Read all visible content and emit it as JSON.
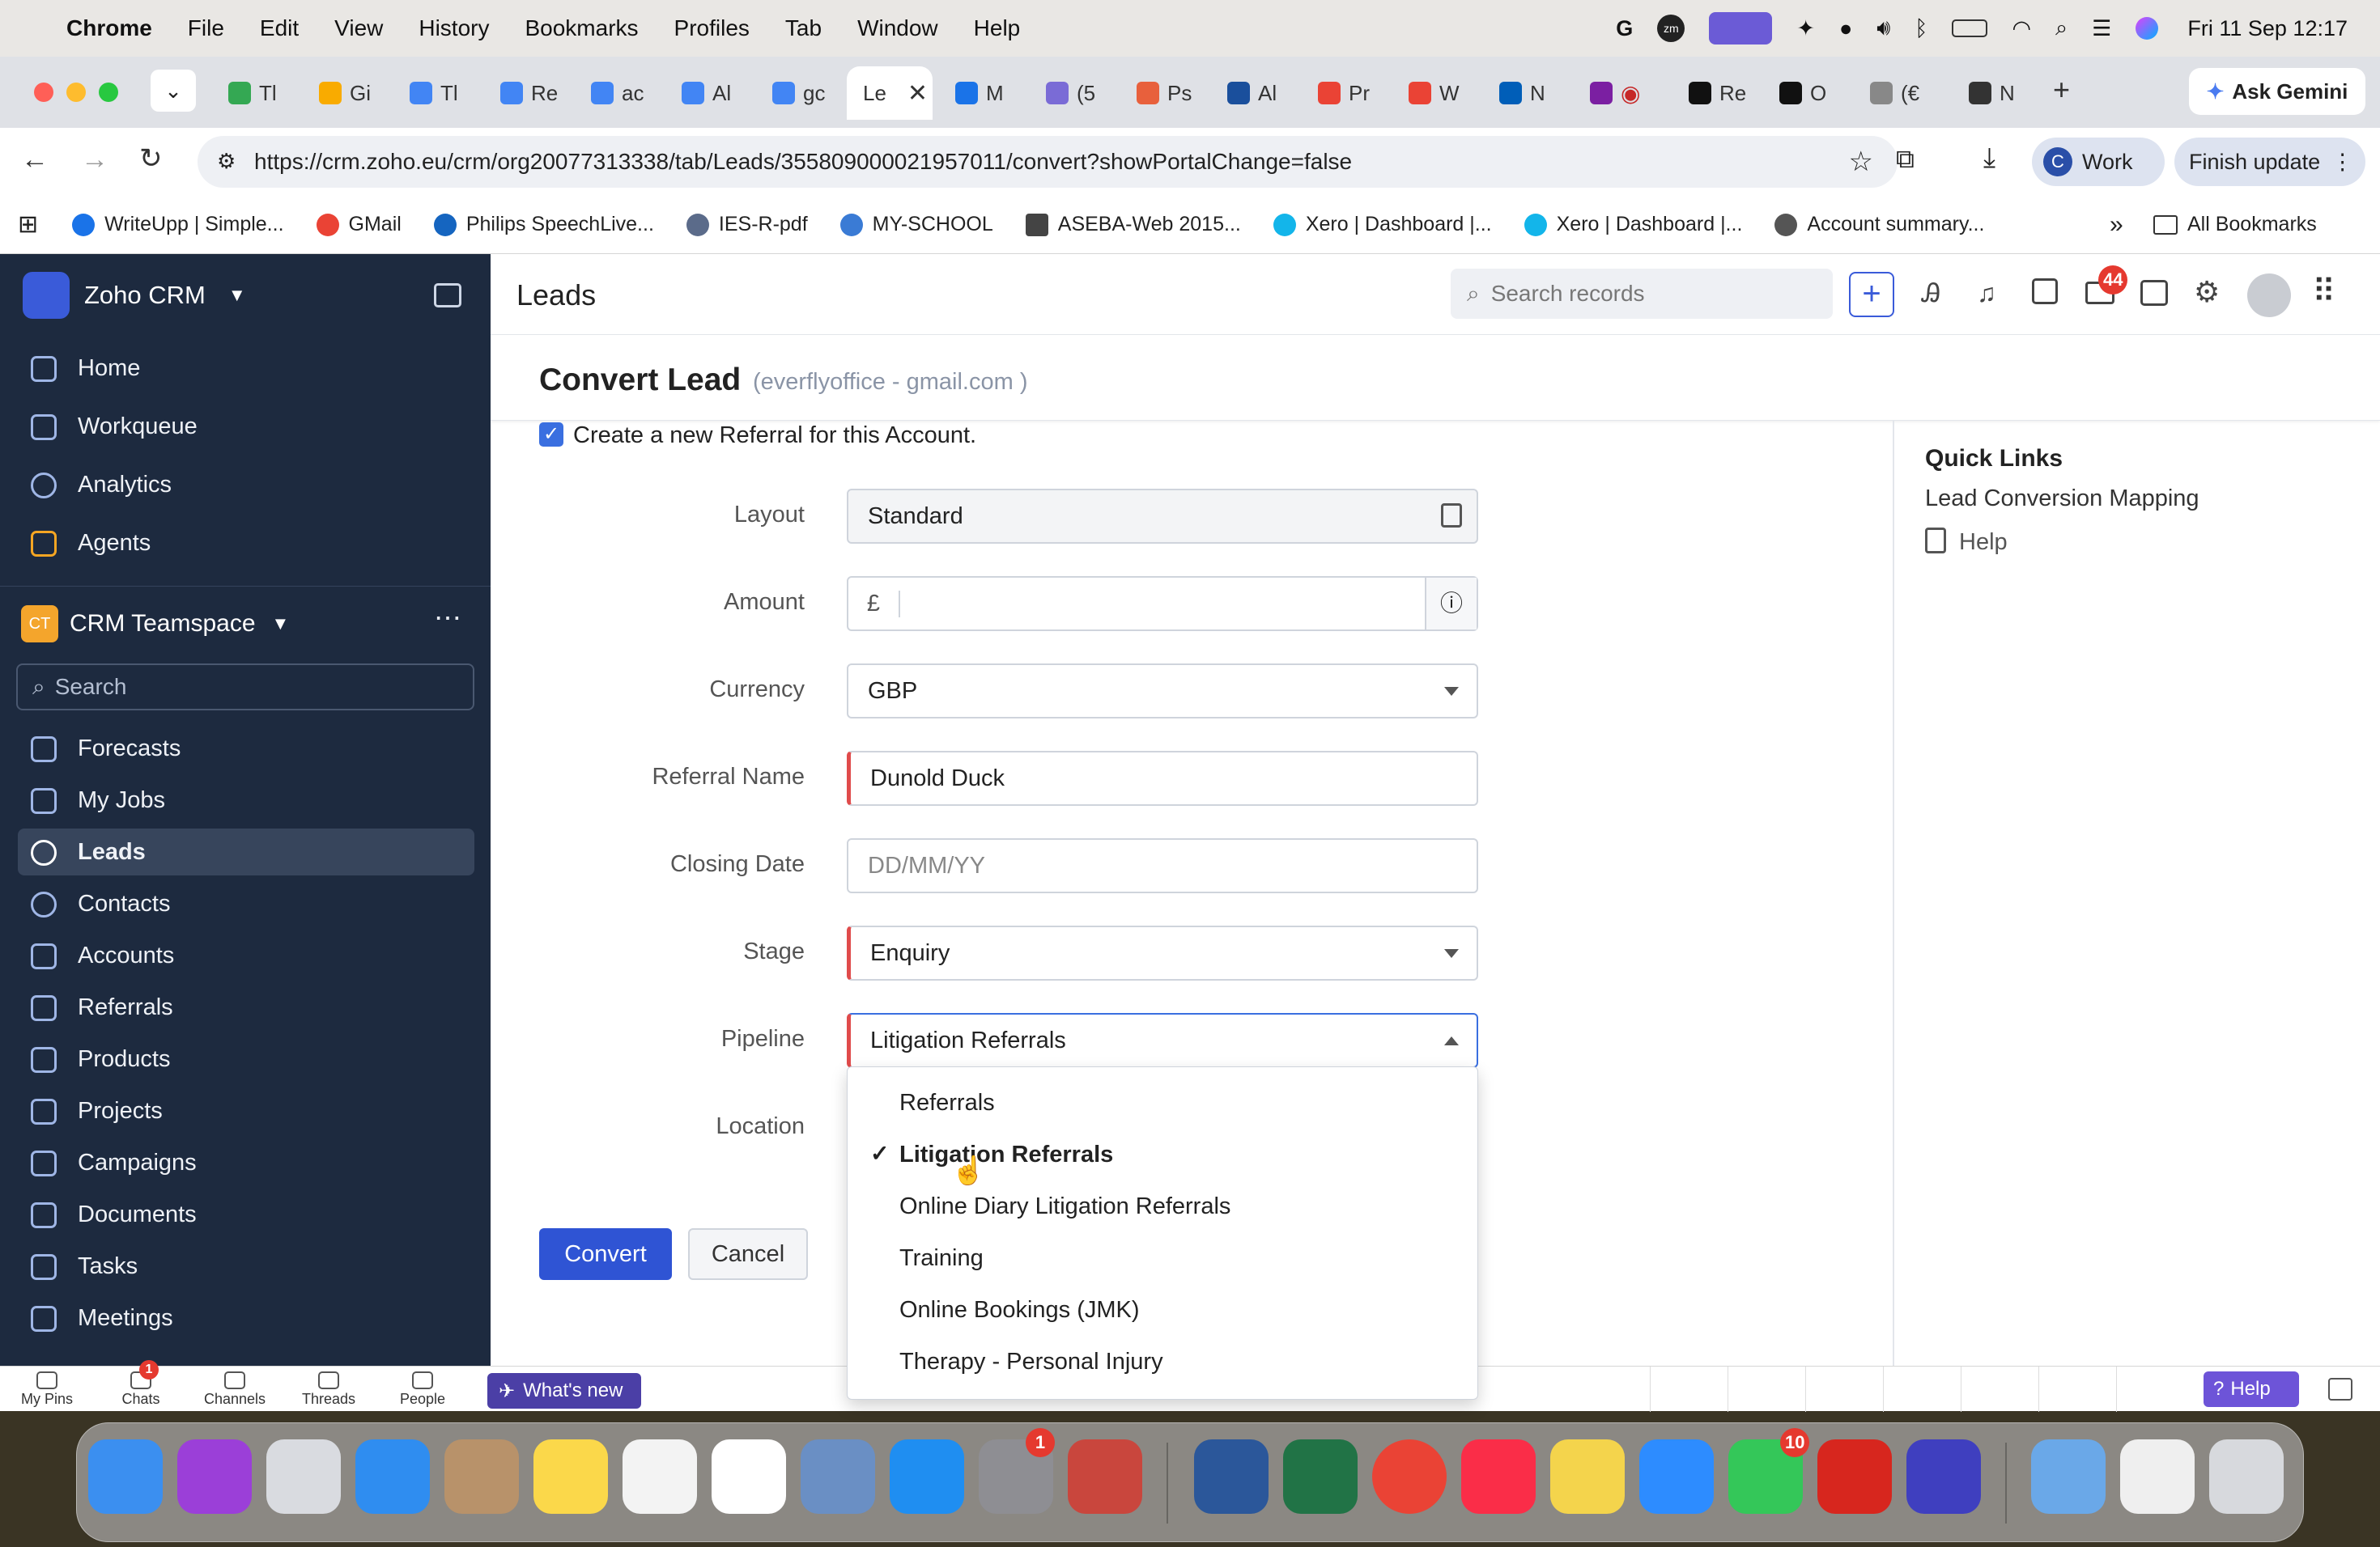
{
  "menubar": {
    "app": "Chrome",
    "items": [
      "File",
      "Edit",
      "View",
      "History",
      "Bookmarks",
      "Profiles",
      "Tab",
      "Window",
      "Help"
    ],
    "clock": "Fri 11 Sep  12:17"
  },
  "tabs": [
    {
      "label": "Tl",
      "color": "#34a853"
    },
    {
      "label": "Gi",
      "color": "#f9ab00"
    },
    {
      "label": "Tl",
      "color": "#4285f4"
    },
    {
      "label": "Re",
      "color": "#4285f4"
    },
    {
      "label": "ac",
      "color": "#4285f4"
    },
    {
      "label": "Al",
      "color": "#4285f4"
    },
    {
      "label": "gc",
      "color": "#4285f4"
    },
    {
      "label": "Le",
      "color": "#ffffff",
      "active": true
    },
    {
      "label": "M",
      "color": "#1a73e8"
    },
    {
      "label": "(5",
      "color": "#7a6bd6"
    },
    {
      "label": "Ps",
      "color": "#e8603c"
    },
    {
      "label": "Al",
      "color": "#1a4f9c"
    },
    {
      "label": "Pr",
      "color": "#ea4335"
    },
    {
      "label": "W",
      "color": "#ea4335"
    },
    {
      "label": "N",
      "color": "#005eb8"
    },
    {
      "label": "",
      "color": "#7b1fa2"
    },
    {
      "label": "Re",
      "color": "#111111"
    },
    {
      "label": "O",
      "color": "#111111"
    },
    {
      "label": "(€",
      "color": "#888888"
    },
    {
      "label": "N",
      "color": "#333333"
    }
  ],
  "browser": {
    "ask_gemini": "Ask Gemini",
    "url": "https://crm.zoho.eu/crm/org20077313338/tab/Leads/355809000021957011/convert?showPortalChange=false",
    "profile": "Work",
    "profile_initial": "C",
    "finish_update": "Finish update"
  },
  "bookmarks": [
    {
      "label": "WriteUpp | Simple...",
      "color": "#1a73e8"
    },
    {
      "label": "GMail",
      "color": "#ea4335"
    },
    {
      "label": "Philips SpeechLive...",
      "color": "#1565c0"
    },
    {
      "label": "IES-R-pdf",
      "color": "#5b6b8a"
    },
    {
      "label": "MY-SCHOOL",
      "color": "#3a7bd5"
    },
    {
      "label": "ASEBA-Web 2015...",
      "color": "#444444"
    },
    {
      "label": "Xero | Dashboard |...",
      "color": "#13b5ea"
    },
    {
      "label": "Xero | Dashboard |...",
      "color": "#13b5ea"
    },
    {
      "label": "Account summary...",
      "color": "#555555"
    }
  ],
  "all_bookmarks": "All Bookmarks",
  "sidebar": {
    "brand": "Zoho CRM",
    "top_items": [
      "Home",
      "Workqueue",
      "Analytics",
      "Agents"
    ],
    "teamspace_badge": "CT",
    "teamspace": "CRM Teamspace",
    "search_placeholder": "Search",
    "items": [
      "Forecasts",
      "My Jobs",
      "Leads",
      "Contacts",
      "Accounts",
      "Referrals",
      "Products",
      "Projects",
      "Campaigns",
      "Documents",
      "Tasks",
      "Meetings"
    ],
    "active_item": "Leads"
  },
  "header": {
    "module": "Leads",
    "search_placeholder": "Search records",
    "notification_count": "44"
  },
  "form": {
    "title": "Convert Lead",
    "subtitle": "(everflyoffice - gmail.com )",
    "checkbox_label": "Create a new Referral for this Account.",
    "checked": true,
    "fields": {
      "layout": {
        "label": "Layout",
        "value": "Standard"
      },
      "amount": {
        "label": "Amount",
        "prefix": "£",
        "value": ""
      },
      "currency": {
        "label": "Currency",
        "value": "GBP"
      },
      "referral_name": {
        "label": "Referral Name",
        "value": "Dunold Duck"
      },
      "closing_date": {
        "label": "Closing Date",
        "placeholder": "DD/MM/YY"
      },
      "stage": {
        "label": "Stage",
        "value": "Enquiry"
      },
      "pipeline": {
        "label": "Pipeline",
        "value": "Litigation Referrals"
      },
      "location": {
        "label": "Location"
      }
    },
    "convert_button": "Convert",
    "cancel_button": "Cancel"
  },
  "pipeline_options": [
    {
      "label": "Referrals",
      "selected": false
    },
    {
      "label": "Litigation Referrals",
      "selected": true
    },
    {
      "label": "Online Diary Litigation Referrals",
      "selected": false
    },
    {
      "label": "Training",
      "selected": false
    },
    {
      "label": "Online Bookings (JMK)",
      "selected": false
    },
    {
      "label": "Therapy - Personal Injury",
      "selected": false
    }
  ],
  "quick_links": {
    "title": "Quick Links",
    "mapping": "Lead Conversion Mapping",
    "help": "Help"
  },
  "bottombar": {
    "items": [
      "My Pins",
      "Chats",
      "Channels",
      "Threads",
      "People"
    ],
    "chats_badge": "1",
    "whats_new": "What's new",
    "help": "Help"
  },
  "dock": {
    "apps": [
      {
        "name": "finder-icon",
        "color": "#3b8ff0"
      },
      {
        "name": "siri-icon",
        "color": "#9b3fd8"
      },
      {
        "name": "launchpad-icon",
        "color": "#d9dbe0"
      },
      {
        "name": "safari-icon",
        "color": "#2f8df0"
      },
      {
        "name": "contacts-icon",
        "color": "#b8926a"
      },
      {
        "name": "notes-icon",
        "color": "#fbd84a"
      },
      {
        "name": "freeform-icon",
        "color": "#f3f3f3"
      },
      {
        "name": "app-icon",
        "color": "#ffffff"
      },
      {
        "name": "preview-icon",
        "color": "#6a8fc4"
      },
      {
        "name": "app-store-icon",
        "color": "#1f8ef1"
      },
      {
        "name": "system-settings-icon",
        "color": "#8e8e93"
      },
      {
        "name": "iphone-mirroring-icon",
        "color": "#c9463d"
      },
      {
        "name": "word-icon",
        "color": "#2b579a"
      },
      {
        "name": "excel-icon",
        "color": "#217346"
      },
      {
        "name": "chrome-icon",
        "color": "#ea4335"
      },
      {
        "name": "music-icon",
        "color": "#fa2d48"
      },
      {
        "name": "app-icon",
        "color": "#f4d44c"
      },
      {
        "name": "zoom-icon",
        "color": "#2d8cff"
      },
      {
        "name": "facetime-icon",
        "color": "#34c759"
      },
      {
        "name": "acrobat-icon",
        "color": "#d7261e"
      },
      {
        "name": "grammarly-icon",
        "color": "#3f3fbf"
      },
      {
        "name": "applications-folder-icon",
        "color": "#6aa8e8"
      },
      {
        "name": "downloads-stack-icon",
        "color": "#efefef"
      },
      {
        "name": "trash-icon",
        "color": "#d7d9dd"
      }
    ],
    "settings_badge": "1",
    "facetime_badge": "10"
  }
}
